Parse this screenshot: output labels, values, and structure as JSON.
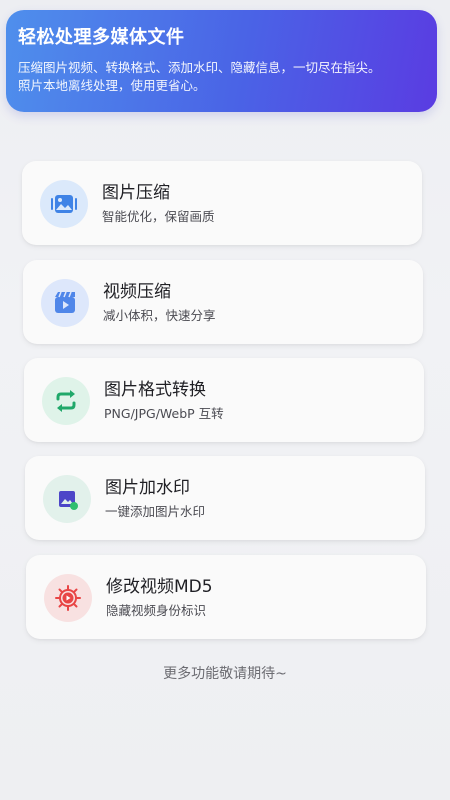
{
  "banner": {
    "title": "轻松处理多媒体文件",
    "description": "压缩图片视频、转换格式、添加水印、隐藏信息，一切尽在指尖。",
    "privacy": "照片本地离线处理，使用更省心。"
  },
  "features": [
    {
      "title": "图片压缩",
      "subtitle": "智能优化，保留画质",
      "icon": "image-compress-icon"
    },
    {
      "title": "视频压缩",
      "subtitle": "减小体积，快速分享",
      "icon": "video-compress-icon"
    },
    {
      "title": "图片格式转换",
      "subtitle": "PNG/JPG/WebP 互转",
      "icon": "convert-arrows-icon"
    },
    {
      "title": "图片加水印",
      "subtitle": "一键添加图片水印",
      "icon": "watermark-icon"
    },
    {
      "title": "修改视频MD5",
      "subtitle": "隐藏视频身份标识",
      "icon": "gear-play-icon"
    }
  ],
  "footer": "更多功能敬请期待~",
  "colors": {
    "banner_start": "#4f8fec",
    "banner_end": "#5a3ce2",
    "image_icon": "#3f83e6",
    "video_icon": "#4f86e9",
    "convert_icon": "#20a86a",
    "watermark_icon": "#4d46c8",
    "md5_icon": "#e84545"
  }
}
